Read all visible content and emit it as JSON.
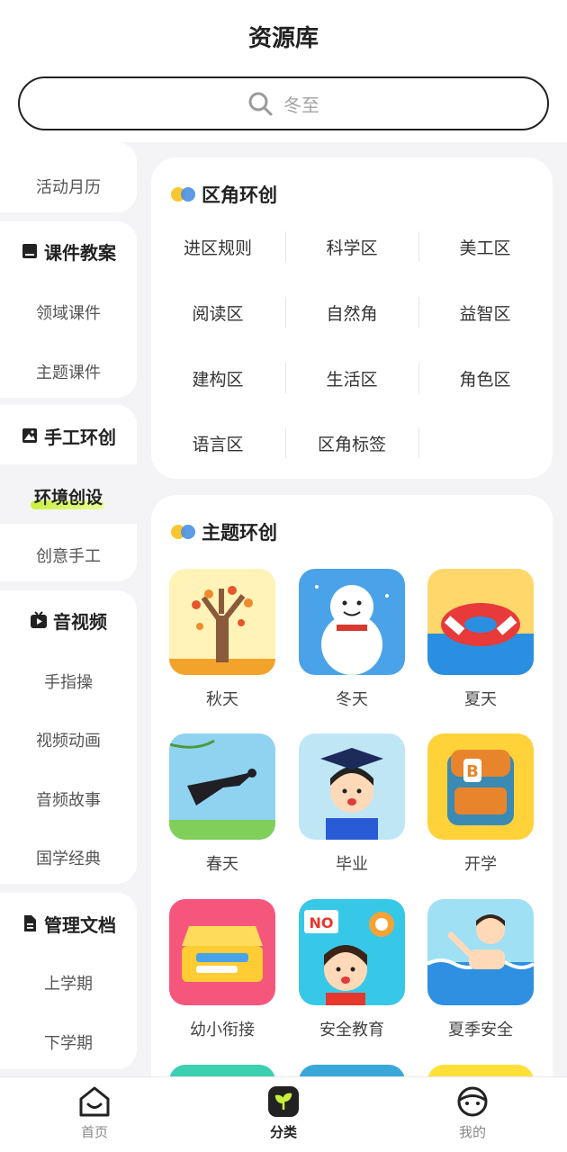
{
  "header": {
    "title": "资源库"
  },
  "search": {
    "placeholder": "冬至"
  },
  "sidebar": {
    "items": [
      {
        "label": "活动月历"
      },
      {
        "label": "课件教案"
      },
      {
        "label": "领域课件"
      },
      {
        "label": "主题课件"
      },
      {
        "label": "手工环创"
      },
      {
        "label": "环境创设"
      },
      {
        "label": "创意手工"
      },
      {
        "label": "音视频"
      },
      {
        "label": "手指操"
      },
      {
        "label": "视频动画"
      },
      {
        "label": "音频故事"
      },
      {
        "label": "国学经典"
      },
      {
        "label": "管理文档"
      },
      {
        "label": "上学期"
      },
      {
        "label": "下学期"
      }
    ],
    "active": "环境创设"
  },
  "area_section": {
    "title": "区角环创",
    "items": [
      "进区规则",
      "科学区",
      "美工区",
      "阅读区",
      "自然角",
      "益智区",
      "建构区",
      "生活区",
      "角色区",
      "语言区",
      "区角标签"
    ]
  },
  "theme_section": {
    "title": "主题环创",
    "items": [
      {
        "label": "秋天",
        "icon": "autumn-tree-icon"
      },
      {
        "label": "冬天",
        "icon": "snowman-icon"
      },
      {
        "label": "夏天",
        "icon": "swim-ring-icon"
      },
      {
        "label": "春天",
        "icon": "swallow-icon"
      },
      {
        "label": "毕业",
        "icon": "graduate-icon"
      },
      {
        "label": "开学",
        "icon": "school-bag-icon"
      },
      {
        "label": "幼小衔接",
        "icon": "pencil-case-icon"
      },
      {
        "label": "安全教育",
        "icon": "safety-girl-icon"
      },
      {
        "label": "夏季安全",
        "icon": "swimming-boy-icon"
      }
    ]
  },
  "bottom_nav": {
    "items": [
      {
        "label": "首页",
        "icon": "home-icon"
      },
      {
        "label": "分类",
        "icon": "sprout-icon"
      },
      {
        "label": "我的",
        "icon": "profile-face-icon"
      }
    ],
    "active": "分类"
  },
  "colors": {
    "accent": "#c9ef3c",
    "dot_yellow": "#f8c630",
    "dot_blue": "#4a90e2",
    "text": "#222222"
  }
}
